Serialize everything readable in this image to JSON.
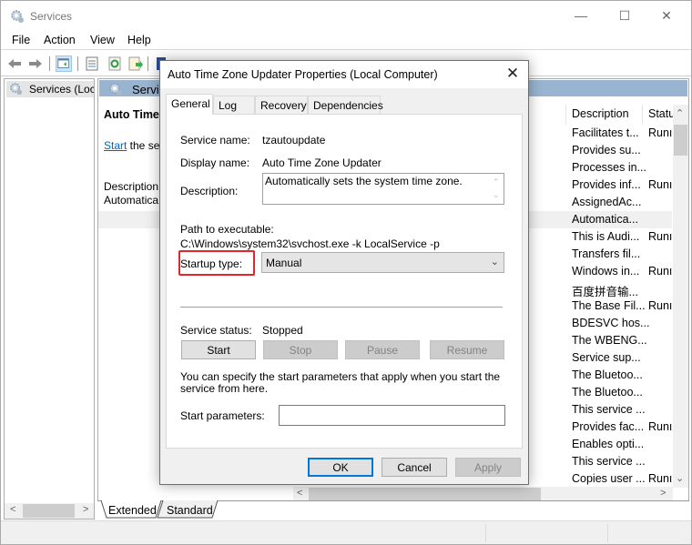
{
  "window": {
    "title": "Services",
    "controls": {
      "minimize": "—",
      "maximize": "☐",
      "close": "✕"
    }
  },
  "menu": [
    "File",
    "Action",
    "View",
    "Help"
  ],
  "tree": {
    "item": "Services (Loca"
  },
  "content": {
    "header": "Servic",
    "extended": {
      "service_title": "Auto Time Z",
      "start_link": "Start",
      "start_rest": " the ser",
      "description_label": "Description:",
      "description_text": "Automatica zone."
    },
    "columns": {
      "description": "Description",
      "status": "Statu"
    },
    "rows": [
      {
        "description": "Facilitates t...",
        "status": "Runı",
        "highlight": false
      },
      {
        "description": "Provides su...",
        "status": "",
        "highlight": false
      },
      {
        "description": "Processes in...",
        "status": "",
        "highlight": false
      },
      {
        "description": "Provides inf...",
        "status": "Runı",
        "highlight": false
      },
      {
        "description": "AssignedAc...",
        "status": "",
        "highlight": false
      },
      {
        "description": "Automatica...",
        "status": "",
        "highlight": true
      },
      {
        "description": "This is Audi...",
        "status": "Runı",
        "highlight": false
      },
      {
        "description": "Transfers fil...",
        "status": "",
        "highlight": false
      },
      {
        "description": "Windows in...",
        "status": "Runı",
        "highlight": false
      },
      {
        "description": "百度拼音输...",
        "status": "",
        "highlight": false
      },
      {
        "description": "The Base Fil...",
        "status": "Runı",
        "highlight": false
      },
      {
        "description": "BDESVC hos...",
        "status": "",
        "highlight": false
      },
      {
        "description": "The WBENG...",
        "status": "",
        "highlight": false
      },
      {
        "description": "Service sup...",
        "status": "",
        "highlight": false
      },
      {
        "description": "The Bluetoo...",
        "status": "",
        "highlight": false
      },
      {
        "description": "The Bluetoo...",
        "status": "",
        "highlight": false
      },
      {
        "description": "This service ...",
        "status": "",
        "highlight": false
      },
      {
        "description": "Provides fac...",
        "status": "Runı",
        "highlight": false
      },
      {
        "description": "Enables opti...",
        "status": "",
        "highlight": false
      },
      {
        "description": "This service ...",
        "status": "",
        "highlight": false
      },
      {
        "description": "Copies user ...",
        "status": "Runı",
        "highlight": false
      }
    ],
    "bottom_tabs": [
      "Extended",
      "Standard"
    ]
  },
  "dialog": {
    "title": "Auto Time Zone Updater Properties (Local Computer)",
    "close": "✕",
    "tabs": [
      "General",
      "Log On",
      "Recovery",
      "Dependencies"
    ],
    "active_tab": "General",
    "fields": {
      "service_name_label": "Service name:",
      "service_name_value": "tzautoupdate",
      "display_name_label": "Display name:",
      "display_name_value": "Auto Time Zone Updater",
      "description_label": "Description:",
      "description_value": "Automatically sets the system time zone.",
      "path_label": "Path to executable:",
      "path_value": "C:\\Windows\\system32\\svchost.exe -k LocalService -p",
      "startup_type_label": "Startup type:",
      "startup_type_value": "Manual",
      "service_status_label": "Service status:",
      "service_status_value": "Stopped",
      "hint": "You can specify the start parameters that apply when you start the service from here.",
      "start_params_label": "Start parameters:",
      "start_params_value": ""
    },
    "service_buttons": [
      {
        "label": "Start",
        "enabled": true
      },
      {
        "label": "Stop",
        "enabled": false
      },
      {
        "label": "Pause",
        "enabled": false
      },
      {
        "label": "Resume",
        "enabled": false
      }
    ],
    "buttons": {
      "ok": "OK",
      "cancel": "Cancel",
      "apply": "Apply"
    },
    "highlight_color": "#e8232a"
  }
}
